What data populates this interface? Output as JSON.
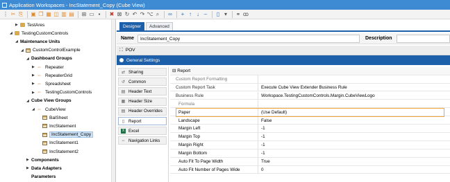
{
  "window": {
    "title": "Application Workspaces - IncStatement_Copy (Cube View)"
  },
  "toolbar": {
    "icons": [
      "grip-icon",
      "cut-icon",
      "paste-icon",
      "separator",
      "new-icon",
      "copy-icon",
      "grid-icon",
      "cube-icon",
      "chart-icon",
      "dashboard-icon",
      "separator",
      "view-icon",
      "folder-icon",
      "save-icon",
      "separator",
      "delete-icon",
      "close-icon",
      "refresh-icon",
      "undo-icon",
      "redo-icon",
      "branch-icon",
      "search-icon",
      "separator",
      "binoculars-icon",
      "separator",
      "add-icon",
      "up-icon",
      "down-icon",
      "minus-icon",
      "separator",
      "page-icon",
      "dropdown-icon",
      "separator",
      "link-icon",
      "glasses-icon"
    ]
  },
  "tree": {
    "items": [
      {
        "label": "TestAres",
        "indent": 1,
        "bold": false,
        "icon": "folder",
        "arrow": "right",
        "selected": false
      },
      {
        "label": "TestingCustomControls",
        "indent": 0,
        "bold": false,
        "icon": "folder",
        "arrow": "down",
        "selected": false
      },
      {
        "label": "Maintenance Units",
        "indent": 1,
        "bold": true,
        "icon": "none",
        "arrow": "down",
        "selected": false
      },
      {
        "label": "CustomControlExample",
        "indent": 2,
        "bold": false,
        "icon": "grid",
        "arrow": "down",
        "selected": false
      },
      {
        "label": "Dashboard Groups",
        "indent": 3,
        "bold": true,
        "icon": "none",
        "arrow": "down",
        "selected": false
      },
      {
        "label": "Repeater",
        "indent": 4,
        "bold": false,
        "icon": "grp",
        "arrow": "right",
        "selected": false
      },
      {
        "label": "RepeaterGrid",
        "indent": 4,
        "bold": false,
        "icon": "grp",
        "arrow": "right",
        "selected": false
      },
      {
        "label": "Spreadsheet",
        "indent": 4,
        "bold": false,
        "icon": "grp",
        "arrow": "right",
        "selected": false
      },
      {
        "label": "TestingCustomControls",
        "indent": 4,
        "bold": false,
        "icon": "grp",
        "arrow": "right",
        "selected": false
      },
      {
        "label": "Cube View Groups",
        "indent": 3,
        "bold": true,
        "icon": "none",
        "arrow": "down",
        "selected": false
      },
      {
        "label": "CubeView",
        "indent": 4,
        "bold": false,
        "icon": "grp",
        "arrow": "down",
        "selected": false
      },
      {
        "label": "BalSheet",
        "indent": 5,
        "bold": false,
        "icon": "grid",
        "arrow": "none",
        "selected": false
      },
      {
        "label": "IncStatement",
        "indent": 5,
        "bold": false,
        "icon": "grid",
        "arrow": "none",
        "selected": false
      },
      {
        "label": "IncStatement_Copy",
        "indent": 5,
        "bold": false,
        "icon": "grid",
        "arrow": "none",
        "selected": true
      },
      {
        "label": "IncStatement1",
        "indent": 5,
        "bold": false,
        "icon": "grid",
        "arrow": "none",
        "selected": false
      },
      {
        "label": "IncStatement2",
        "indent": 5,
        "bold": false,
        "icon": "grid",
        "arrow": "none",
        "selected": false
      },
      {
        "label": "Components",
        "indent": 3,
        "bold": true,
        "icon": "none",
        "arrow": "right",
        "selected": false
      },
      {
        "label": "Data Adapters",
        "indent": 3,
        "bold": true,
        "icon": "none",
        "arrow": "right",
        "selected": false
      },
      {
        "label": "Parameters",
        "indent": 3,
        "bold": true,
        "icon": "none",
        "arrow": "none",
        "selected": false
      }
    ]
  },
  "tabs": [
    {
      "label": "Designer",
      "active": true
    },
    {
      "label": "Advanced",
      "active": false
    }
  ],
  "name_bar": {
    "name_label": "Name",
    "name_value": "IncStatement_Copy",
    "description_label": "Description",
    "description_value": ""
  },
  "pov": {
    "label": "POV",
    "icon": "pov-icon"
  },
  "general_settings": {
    "label": "General Settings"
  },
  "categories": [
    {
      "label": "Sharing",
      "icon": "share-icon",
      "selected": false
    },
    {
      "label": "Common",
      "icon": "common-icon",
      "selected": false
    },
    {
      "label": "Header Text",
      "icon": "header-text-icon",
      "selected": false
    },
    {
      "label": "Header Size",
      "icon": "header-size-icon",
      "selected": false
    },
    {
      "label": "Header Overrides",
      "icon": "header-overrides-icon",
      "selected": false
    },
    {
      "label": "Report",
      "icon": "report-icon",
      "selected": true
    },
    {
      "label": "Excel",
      "icon": "excel-icon",
      "selected": false
    },
    {
      "label": "Navigation Links",
      "icon": "navigation-icon",
      "selected": false
    }
  ],
  "properties": {
    "section": "Report",
    "collapse_glyph": "⊟",
    "rows": [
      {
        "name": "Custom Report Formatting",
        "value": "",
        "kind": "sub-header"
      },
      {
        "name": "Custom Report Task",
        "value": "Execute Cube View Extender Business Rule",
        "kind": "sub"
      },
      {
        "name": "Business Rule",
        "value": "Workspace.TestingCustomControls.Margin.CubeViewLogo",
        "kind": "sub"
      },
      {
        "name": "Formula",
        "value": "",
        "kind": "grey"
      },
      {
        "name": "Paper",
        "value": "(Use Default)",
        "kind": "normal"
      },
      {
        "name": "Landscape",
        "value": "False",
        "kind": "normal"
      },
      {
        "name": "Margin Left",
        "value": "-1",
        "kind": "normal"
      },
      {
        "name": "Margin Top",
        "value": "-1",
        "kind": "normal"
      },
      {
        "name": "Margin Right",
        "value": "-1",
        "kind": "normal"
      },
      {
        "name": "Margin Bottom",
        "value": "-1",
        "kind": "normal"
      },
      {
        "name": "Auto Fit To Page Width",
        "value": "True",
        "kind": "normal"
      },
      {
        "name": "Auto Fit Number of Pages Wide",
        "value": "0",
        "kind": "normal"
      }
    ]
  },
  "colors": {
    "titlebar": "#3f8bd3",
    "accent": "#1d5fa8",
    "highlight": "#f0a53a",
    "selection": "#cfe3f7"
  }
}
